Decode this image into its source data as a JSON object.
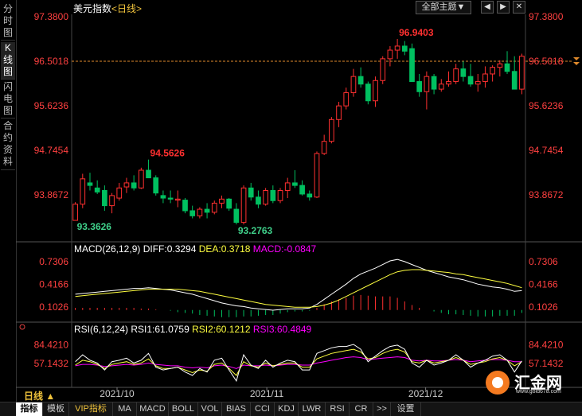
{
  "sidebar": {
    "tabs": [
      {
        "label": "分时图",
        "active": false
      },
      {
        "label": "K线图",
        "active": true
      },
      {
        "label": "闪电图",
        "active": false
      },
      {
        "label": "合约资料",
        "active": false
      }
    ]
  },
  "header": {
    "title": "美元指数",
    "period_tag": "<日线>",
    "theme_button": "全部主题▼",
    "window_buttons": [
      "◀",
      "▶",
      "✕"
    ]
  },
  "period_selector": "日线 ▲",
  "bottom_tabs": [
    "指标",
    "模板",
    "VIP指标",
    "MA",
    "MACD",
    "BOLL",
    "VOL",
    "BIAS",
    "CCI",
    "KDJ",
    "LWR",
    "RSI",
    "CR",
    ">>",
    "设置"
  ],
  "bottom_tabs_active": "指标",
  "logo": {
    "name": "汇金网",
    "url": "www.gold678.com"
  },
  "colors": {
    "up": "#ff3030",
    "down": "#00c060",
    "background": "#000000",
    "price_label": "#ff3030",
    "macd_diff": "#ffffff",
    "macd_dea": "#ffff40",
    "macd_hist": "#ff00ff",
    "rsi1": "#ffffff",
    "rsi2": "#ffff40",
    "rsi3": "#ff00ff",
    "axis": "#ff4040"
  },
  "chart_data": [
    {
      "type": "candlestick",
      "title": "美元指数",
      "yticks": [
        "97.3800",
        "96.5018",
        "95.6236",
        "94.7454",
        "93.8672"
      ],
      "ylim": [
        93.0,
        97.38
      ],
      "xticks": [
        "2021/10",
        "2021/11",
        "2021/12"
      ],
      "reference_line": 96.5018,
      "annotations": [
        {
          "label": "96.9403",
          "kind": "high"
        },
        {
          "label": "94.5626",
          "kind": "high"
        },
        {
          "label": "93.3626",
          "kind": "low"
        },
        {
          "label": "93.2763",
          "kind": "low"
        }
      ],
      "ohlc": [
        [
          93.36,
          93.72,
          93.36,
          93.68
        ],
        [
          93.68,
          94.28,
          93.6,
          94.18
        ],
        [
          94.1,
          94.3,
          93.95,
          94.05
        ],
        [
          94.0,
          94.15,
          93.88,
          93.92
        ],
        [
          93.95,
          94.05,
          93.55,
          93.65
        ],
        [
          93.65,
          93.9,
          93.5,
          93.85
        ],
        [
          93.8,
          94.1,
          93.75,
          94.0
        ],
        [
          94.02,
          94.2,
          93.9,
          94.1
        ],
        [
          94.1,
          94.25,
          93.95,
          94.0
        ],
        [
          94.0,
          94.4,
          93.98,
          94.35
        ],
        [
          94.35,
          94.56,
          94.2,
          94.2
        ],
        [
          94.2,
          94.25,
          93.85,
          93.9
        ],
        [
          93.85,
          93.95,
          93.7,
          93.8
        ],
        [
          93.8,
          93.95,
          93.7,
          93.78
        ],
        [
          93.76,
          93.95,
          93.62,
          93.78
        ],
        [
          93.76,
          93.8,
          93.5,
          93.55
        ],
        [
          93.55,
          93.65,
          93.4,
          93.45
        ],
        [
          93.45,
          93.62,
          93.4,
          93.58
        ],
        [
          93.58,
          93.7,
          93.4,
          93.52
        ],
        [
          93.52,
          93.75,
          93.48,
          93.7
        ],
        [
          93.7,
          93.85,
          93.6,
          93.78
        ],
        [
          93.78,
          93.8,
          93.55,
          93.6
        ],
        [
          93.58,
          93.7,
          93.28,
          93.32
        ],
        [
          93.32,
          94.05,
          93.28,
          94.0
        ],
        [
          94.0,
          94.1,
          93.75,
          93.82
        ],
        [
          93.82,
          93.95,
          93.6,
          93.68
        ],
        [
          93.68,
          94.0,
          93.65,
          93.95
        ],
        [
          93.95,
          94.05,
          93.7,
          93.75
        ],
        [
          93.75,
          94.0,
          93.7,
          93.95
        ],
        [
          93.95,
          94.2,
          93.8,
          94.1
        ],
        [
          94.1,
          94.35,
          94.0,
          94.05
        ],
        [
          94.05,
          94.15,
          93.85,
          93.88
        ],
        [
          93.88,
          93.95,
          93.75,
          93.82
        ],
        [
          93.82,
          94.72,
          93.8,
          94.68
        ],
        [
          94.68,
          95.05,
          94.65,
          94.92
        ],
        [
          94.92,
          95.4,
          94.88,
          95.35
        ],
        [
          95.35,
          95.7,
          95.2,
          95.62
        ],
        [
          95.62,
          95.98,
          95.55,
          95.88
        ],
        [
          95.88,
          96.35,
          95.8,
          96.2
        ],
        [
          96.2,
          96.38,
          95.98,
          96.05
        ],
        [
          96.05,
          96.1,
          95.65,
          95.72
        ],
        [
          95.72,
          96.2,
          95.6,
          96.12
        ],
        [
          96.12,
          96.6,
          96.05,
          96.55
        ],
        [
          96.55,
          96.8,
          96.4,
          96.72
        ],
        [
          96.72,
          96.94,
          96.55,
          96.8
        ],
        [
          96.8,
          96.9,
          96.62,
          96.7
        ],
        [
          96.75,
          96.85,
          96.1,
          96.1
        ],
        [
          96.1,
          96.25,
          95.8,
          95.9
        ],
        [
          95.9,
          96.3,
          95.55,
          96.2
        ],
        [
          96.2,
          96.25,
          95.85,
          95.95
        ],
        [
          95.95,
          96.15,
          95.9,
          96.05
        ],
        [
          96.05,
          96.3,
          96.0,
          96.1
        ],
        [
          96.1,
          96.45,
          96.05,
          96.35
        ],
        [
          96.35,
          96.5,
          96.1,
          96.2
        ],
        [
          96.2,
          96.45,
          96.0,
          96.05
        ],
        [
          96.05,
          96.25,
          95.9,
          96.1
        ],
        [
          96.1,
          96.4,
          95.98,
          96.25
        ],
        [
          96.25,
          96.42,
          96.1,
          96.38
        ],
        [
          96.38,
          96.52,
          96.2,
          96.45
        ],
        [
          96.45,
          96.7,
          96.25,
          96.3
        ],
        [
          96.3,
          96.6,
          96.15,
          95.95
        ],
        [
          95.95,
          96.65,
          95.85,
          96.6
        ]
      ]
    },
    {
      "type": "line",
      "title": "MACD(26,12,9)",
      "labels": {
        "diff": "DIFF:0.3294",
        "dea": "DEA:0.3718",
        "macd": "MACD:-0.0847"
      },
      "yticks": [
        "0.7306",
        "0.4166",
        "0.1026"
      ],
      "ylim": [
        -0.05,
        0.85
      ],
      "series": [
        {
          "name": "DIFF",
          "values": [
            0.28,
            0.29,
            0.3,
            0.31,
            0.32,
            0.33,
            0.34,
            0.35,
            0.36,
            0.36,
            0.37,
            0.36,
            0.35,
            0.34,
            0.32,
            0.3,
            0.28,
            0.25,
            0.22,
            0.19,
            0.16,
            0.14,
            0.12,
            0.11,
            0.09,
            0.08,
            0.07,
            0.06,
            0.07,
            0.08,
            0.08,
            0.08,
            0.09,
            0.14,
            0.21,
            0.28,
            0.35,
            0.42,
            0.5,
            0.56,
            0.6,
            0.64,
            0.69,
            0.74,
            0.76,
            0.73,
            0.69,
            0.65,
            0.61,
            0.58,
            0.55,
            0.52,
            0.5,
            0.48,
            0.45,
            0.42,
            0.4,
            0.38,
            0.37,
            0.35,
            0.32,
            0.33
          ]
        },
        {
          "name": "DEA",
          "values": [
            0.25,
            0.26,
            0.27,
            0.28,
            0.29,
            0.3,
            0.31,
            0.32,
            0.33,
            0.34,
            0.35,
            0.35,
            0.35,
            0.35,
            0.35,
            0.34,
            0.33,
            0.32,
            0.3,
            0.28,
            0.26,
            0.24,
            0.22,
            0.2,
            0.18,
            0.16,
            0.14,
            0.13,
            0.12,
            0.11,
            0.1,
            0.1,
            0.1,
            0.11,
            0.13,
            0.16,
            0.2,
            0.25,
            0.3,
            0.35,
            0.4,
            0.45,
            0.5,
            0.55,
            0.59,
            0.61,
            0.62,
            0.62,
            0.61,
            0.6,
            0.59,
            0.58,
            0.56,
            0.55,
            0.53,
            0.51,
            0.49,
            0.47,
            0.45,
            0.43,
            0.4,
            0.37
          ]
        },
        {
          "name": "MACD",
          "values": [
            0.06,
            0.06,
            0.06,
            0.06,
            0.06,
            0.06,
            0.06,
            0.06,
            0.06,
            0.04,
            0.04,
            0.02,
            0.0,
            -0.02,
            -0.06,
            -0.08,
            -0.1,
            -0.14,
            -0.16,
            -0.18,
            -0.2,
            -0.2,
            -0.2,
            -0.18,
            -0.18,
            -0.16,
            -0.14,
            -0.14,
            -0.1,
            -0.06,
            -0.04,
            -0.04,
            -0.02,
            0.06,
            0.16,
            0.24,
            0.3,
            0.34,
            0.4,
            0.42,
            0.4,
            0.38,
            0.38,
            0.38,
            0.34,
            0.24,
            0.14,
            0.06,
            0.0,
            -0.04,
            -0.08,
            -0.12,
            -0.12,
            -0.14,
            -0.16,
            -0.18,
            -0.18,
            -0.18,
            -0.16,
            -0.16,
            -0.16,
            -0.08
          ]
        }
      ]
    },
    {
      "type": "line",
      "title": "RSI(6,12,24)",
      "labels": {
        "rsi1": "RSI1:61.0759",
        "rsi2": "RSI2:60.1212",
        "rsi3": "RSI3:60.4849"
      },
      "yticks": [
        "84.4210",
        "57.1432"
      ],
      "ylim": [
        25,
        100
      ],
      "series": [
        {
          "name": "RSI1",
          "values": [
            60,
            70,
            62,
            58,
            48,
            60,
            62,
            65,
            58,
            62,
            72,
            52,
            48,
            50,
            52,
            45,
            40,
            50,
            45,
            62,
            65,
            48,
            32,
            70,
            55,
            50,
            62,
            52,
            58,
            62,
            60,
            48,
            48,
            72,
            76,
            80,
            82,
            82,
            85,
            78,
            60,
            68,
            76,
            82,
            84,
            78,
            58,
            52,
            62,
            55,
            58,
            62,
            70,
            62,
            52,
            58,
            62,
            68,
            70,
            62,
            45,
            61
          ]
        },
        {
          "name": "RSI2",
          "values": [
            55,
            62,
            60,
            56,
            50,
            56,
            58,
            60,
            56,
            58,
            64,
            54,
            50,
            50,
            52,
            48,
            44,
            48,
            46,
            56,
            58,
            50,
            40,
            60,
            54,
            52,
            58,
            54,
            56,
            58,
            58,
            52,
            52,
            64,
            68,
            72,
            74,
            76,
            78,
            74,
            64,
            66,
            72,
            76,
            78,
            74,
            60,
            58,
            62,
            58,
            60,
            62,
            66,
            62,
            56,
            58,
            60,
            64,
            66,
            62,
            54,
            60
          ]
        },
        {
          "name": "RSI3",
          "values": [
            54,
            56,
            56,
            55,
            53,
            54,
            55,
            56,
            55,
            56,
            58,
            56,
            55,
            54,
            54,
            52,
            51,
            52,
            51,
            54,
            55,
            53,
            50,
            55,
            54,
            54,
            55,
            54,
            55,
            56,
            56,
            55,
            55,
            58,
            60,
            62,
            64,
            66,
            67,
            66,
            63,
            64,
            65,
            66,
            67,
            66,
            62,
            61,
            62,
            61,
            61,
            62,
            63,
            62,
            60,
            61,
            62,
            63,
            63,
            62,
            60,
            60
          ]
        }
      ]
    }
  ]
}
